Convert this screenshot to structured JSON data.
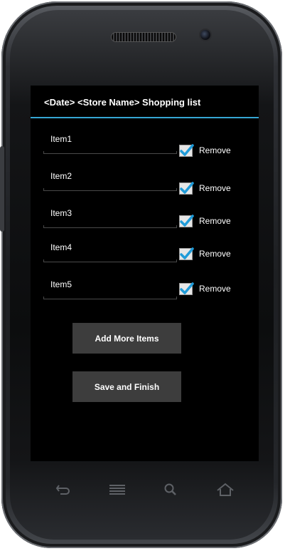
{
  "app": {
    "title": "<Date> <Store Name> Shopping list"
  },
  "items": [
    {
      "name": "Item1",
      "remove_label": "Remove",
      "checked": true
    },
    {
      "name": "Item2",
      "remove_label": "Remove",
      "checked": true
    },
    {
      "name": "Item3",
      "remove_label": "Remove",
      "checked": true
    },
    {
      "name": "Item4",
      "remove_label": "Remove",
      "checked": true
    },
    {
      "name": "Item5",
      "remove_label": "Remove",
      "checked": true
    }
  ],
  "actions": {
    "add_more_label": "Add More Items",
    "save_finish_label": "Save and Finish"
  },
  "navigation": {
    "keys": [
      "back-icon",
      "menu-icon",
      "search-icon",
      "home-icon"
    ]
  },
  "colors": {
    "accent": "#35a6d3",
    "screen_background": "#000000",
    "button_background": "#3d3d3d",
    "checkmark": "#1f9bd8"
  }
}
